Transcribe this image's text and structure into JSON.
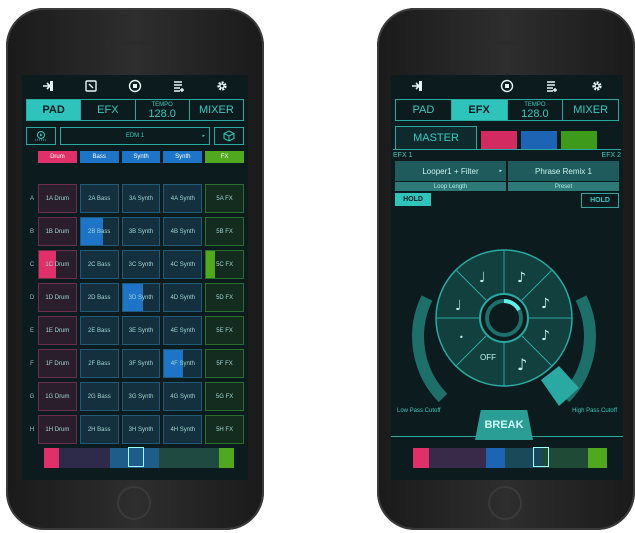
{
  "pad_screen": {
    "tabs": {
      "pad": "PAD",
      "efx": "EFX",
      "tempo_label": "TEMPO",
      "tempo_value": "128.0",
      "mixer": "MIXER"
    },
    "preset_name": "EDM 1",
    "columns": [
      {
        "label": "Drum",
        "color": "#e0306a"
      },
      {
        "label": "Bass",
        "color": "#1e74c6"
      },
      {
        "label": "Synth",
        "color": "#1e74c6"
      },
      {
        "label": "Synth",
        "color": "#1e74c6"
      },
      {
        "label": "FX",
        "color": "#4fa81e"
      }
    ],
    "rows": [
      {
        "label": "A",
        "pads": [
          "1A Drum",
          "2A Bass",
          "3A Synth",
          "4A Synth",
          "5A FX"
        ]
      },
      {
        "label": "B",
        "pads": [
          "1B Drum",
          "2B Bass",
          "3B Synth",
          "4B Synth",
          "5B FX"
        ]
      },
      {
        "label": "C",
        "pads": [
          "1C Drum",
          "2C Bass",
          "3C Synth",
          "4C Synth",
          "5C FX"
        ]
      },
      {
        "label": "D",
        "pads": [
          "1D Drum",
          "2D Bass",
          "3D Synth",
          "4D Synth",
          "5D FX"
        ]
      },
      {
        "label": "E",
        "pads": [
          "1E Drum",
          "2E Bass",
          "3E Synth",
          "4E Synth",
          "5E FX"
        ]
      },
      {
        "label": "F",
        "pads": [
          "1F Drum",
          "2F Bass",
          "3F Synth",
          "4F Synth",
          "5F FX"
        ]
      },
      {
        "label": "G",
        "pads": [
          "1G Drum",
          "2G Bass",
          "3G Synth",
          "4G Synth",
          "5G FX"
        ]
      },
      {
        "label": "H",
        "pads": [
          "1H Drum",
          "2H Bass",
          "3H Synth",
          "4H Synth",
          "5H FX"
        ]
      }
    ],
    "colors": {
      "drum": "#e0306a",
      "bass": "#1e74c6",
      "fx": "#4fa81e",
      "accent": "#2ec4bc"
    }
  },
  "efx_screen": {
    "tabs": {
      "pad": "PAD",
      "efx": "EFX",
      "tempo_label": "TEMPO",
      "tempo_value": "128.0",
      "mixer": "MIXER"
    },
    "master_label": "MASTER",
    "efx1_label": "EFX 1",
    "efx2_label": "EFX 2",
    "efx1_name": "Looper1 + Filter",
    "efx1_param": "Loop Length",
    "efx2_name": "Phrase Remix 1",
    "efx2_param": "Preset",
    "hold_left": "HOLD",
    "hold_right": "HOLD",
    "wheel_off": "OFF",
    "break_label": "BREAK",
    "low_pass_label": "Low Pass Cutoff",
    "high_pass_label": "High Pass Cutoff"
  }
}
